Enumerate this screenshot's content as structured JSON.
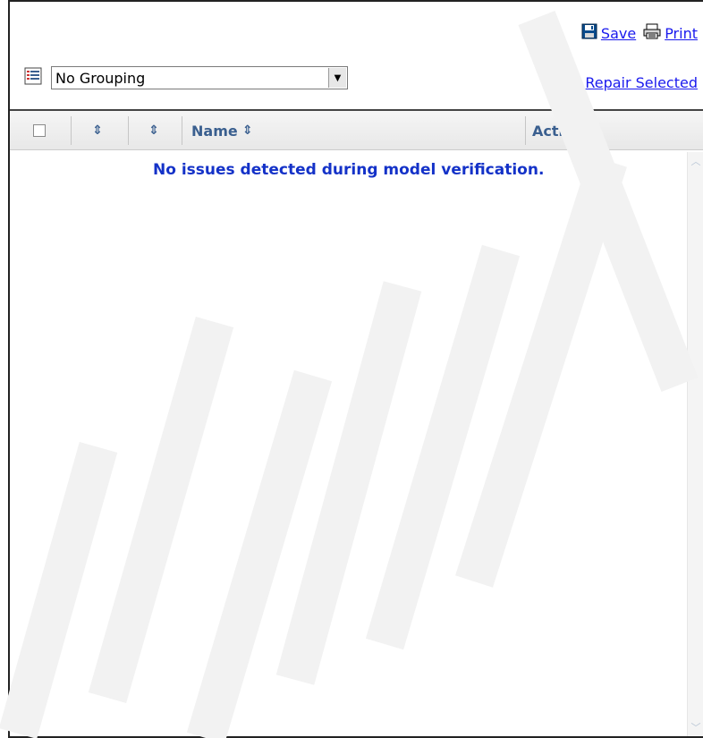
{
  "toolbar": {
    "save_label": "Save",
    "print_label": "Print",
    "repair_label": "Repair Selected"
  },
  "grouping": {
    "selected": "No Grouping"
  },
  "table": {
    "columns": [
      {
        "id": "select",
        "label": ""
      },
      {
        "id": "sort1",
        "label": ""
      },
      {
        "id": "sort2",
        "label": ""
      },
      {
        "id": "name",
        "label": "Name"
      },
      {
        "id": "actions",
        "label": "Actions"
      }
    ]
  },
  "message": "No issues detected during model verification.",
  "colors": {
    "link": "#1a1aee",
    "header_text": "#3a5f8f",
    "message": "#1432c8"
  },
  "icons": {
    "save": "floppy-disk-icon",
    "print": "printer-icon",
    "repair": "wrench-icon",
    "grouping": "list-icon"
  }
}
